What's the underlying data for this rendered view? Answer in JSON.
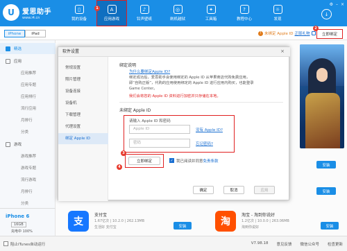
{
  "app": {
    "logo_char": "U",
    "title": "爱思助手",
    "url": "www.i4.cn"
  },
  "colors": {
    "accent": "#1a8ee6",
    "highlight": "#e02020",
    "warning": "#e07b1a"
  },
  "nav": [
    {
      "label": "我的设备",
      "icon": "phone-icon",
      "glyph": "▯"
    },
    {
      "label": "应用游戏",
      "icon": "apps-icon",
      "glyph": "A",
      "badge": "1"
    },
    {
      "label": "铃声壁纸",
      "icon": "bell-icon",
      "glyph": "♪"
    },
    {
      "label": "刷机越狱",
      "icon": "box-icon",
      "glyph": "◎"
    },
    {
      "label": "工具箱",
      "icon": "toolbox-icon",
      "glyph": "✦"
    },
    {
      "label": "教程中心",
      "icon": "book-icon",
      "glyph": "?"
    },
    {
      "label": "发现",
      "icon": "discover-icon",
      "glyph": "☼"
    }
  ],
  "subbar": {
    "tab_iphone": "iPhone",
    "tab_ipad": "iPad",
    "unbound_text": "未绑定 Apple ID",
    "warn_glyph": "!",
    "gift_link": "正版礼物",
    "bind_now": "立即绑定",
    "badge2": "2"
  },
  "sidebar": {
    "items": [
      {
        "label": "精选",
        "type": "group",
        "active": true
      },
      {
        "label": "应用",
        "type": "group"
      },
      {
        "label": "应用推荐",
        "type": "sub"
      },
      {
        "label": "应用专题",
        "type": "sub"
      },
      {
        "label": "应用排行",
        "type": "sub"
      },
      {
        "label": "流行应用",
        "type": "sub"
      },
      {
        "label": "月排行",
        "type": "sub"
      },
      {
        "label": "分类",
        "type": "sub"
      },
      {
        "label": "游戏",
        "type": "group"
      },
      {
        "label": "游戏推荐",
        "type": "sub"
      },
      {
        "label": "游戏专题",
        "type": "sub"
      },
      {
        "label": "流行游戏",
        "type": "sub"
      },
      {
        "label": "月排行",
        "type": "sub"
      },
      {
        "label": "分类",
        "type": "sub"
      }
    ]
  },
  "device": {
    "name": "iPhone 6",
    "capacity": "16GB",
    "battery": "充电中 100%"
  },
  "status": {
    "block_itunes": "阻止iTunes自动运行",
    "version": "V7.98.18",
    "feedback": "意见反馈",
    "wechat": "微信公众号",
    "update": "检查更新"
  },
  "side_buttons": [
    "立即绑定",
    "安装",
    "安装",
    "安装"
  ],
  "apps": [
    {
      "name": "支付宝",
      "meta": "1.67亿次 | 10.2.0 | 262.13MB",
      "desc": "生活好 支付宝",
      "icon_char": "支",
      "icon_color": "#1677ff",
      "install": "安装"
    },
    {
      "name": "淘宝 - 淘到你说好",
      "meta": "1.2亿次 | 10.0.0 | 263.06MB",
      "desc": "淘到你说好",
      "icon_char": "淘",
      "icon_color": "#ff5000",
      "install": "安装"
    }
  ],
  "dialog": {
    "title": "软件设置",
    "close": "×",
    "menu": [
      "常规设置",
      "照片管理",
      "设备连接",
      "设备机",
      "下载管理",
      "代理设置",
      "绑定 Apple ID"
    ],
    "section1_title": "绑定说明",
    "section1_link": "为什么要绑定Apple ID?",
    "section1_body": "绑定成功后，爱思助手会使用绑定的 Apple ID 从苹果商店代购免费应用，即“自购正版”，代购的应用使用绑定的 Apple ID 进行应用内购买，也能登录 Game Center。",
    "section1_warn": "我们会将您的 Apple ID 资料进行加密并只存储在本地。",
    "section2_title": "未绑定 Apple ID",
    "form_label": "请输入 Apple ID 和密码",
    "apple_id_placeholder": "Apple ID",
    "password_placeholder": "密码",
    "no_apple_id": "没有 Apple ID?",
    "forgot_password": "忘记密码?",
    "bind_button": "立即绑定",
    "agree_prefix": "我已阅读并同意",
    "agree_link": "免责条款",
    "check_glyph": "✓",
    "badge3": "3",
    "badge4": "4",
    "ok": "确定",
    "cancel": "取消",
    "apply": "应用"
  }
}
